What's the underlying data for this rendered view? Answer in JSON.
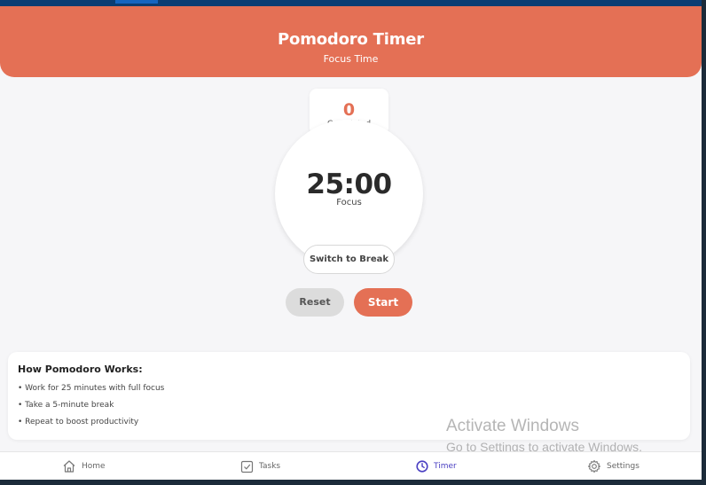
{
  "header": {
    "title": "Pomodoro Timer",
    "subtitle": "Focus Time",
    "color": "#e47055"
  },
  "stats": {
    "completed_count": "0",
    "completed_label": "Completed Sessions"
  },
  "timer": {
    "time": "25:00",
    "mode": "Focus",
    "switch_label": "Switch to Break"
  },
  "controls": {
    "reset_label": "Reset",
    "start_label": "Start"
  },
  "info": {
    "title": "How Pomodoro Works:",
    "items": [
      "• Work for 25 minutes with full focus",
      "• Take a 5-minute break",
      "• Repeat to boost productivity"
    ]
  },
  "watermark": {
    "line1": "Activate Windows",
    "line2": "Go to Settings to activate Windows."
  },
  "nav": {
    "items": [
      {
        "label": "Home",
        "icon": "home-icon"
      },
      {
        "label": "Tasks",
        "icon": "checkbox-icon"
      },
      {
        "label": "Timer",
        "icon": "timer-icon",
        "active": true
      },
      {
        "label": "Settings",
        "icon": "gear-icon"
      }
    ],
    "active_color": "#4a3fc2"
  }
}
